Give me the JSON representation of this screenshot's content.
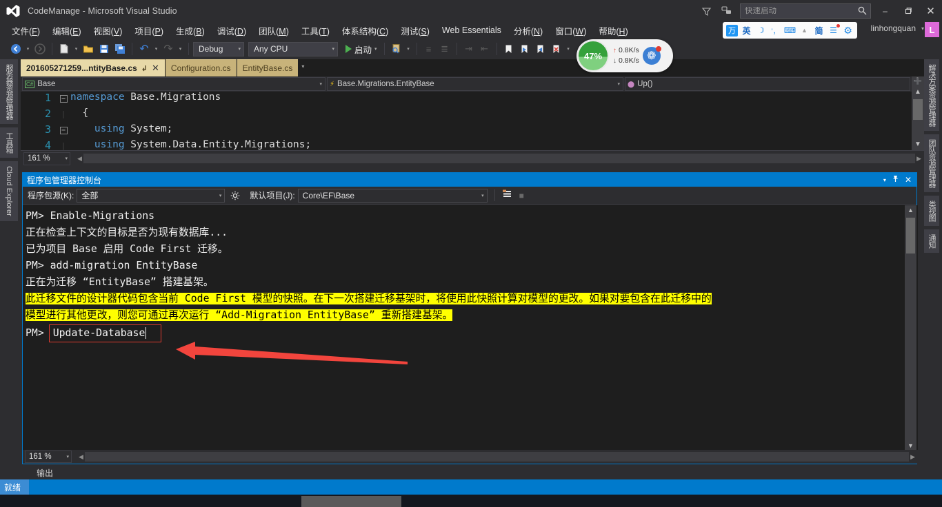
{
  "window": {
    "title": "CodeManage - Microsoft Visual Studio",
    "logo_icon": "visual-studio-logo",
    "minimize_label": "–",
    "maximize_label": "❐",
    "close_label": "✕"
  },
  "titlebar_icons": {
    "feedback_icon": "▽",
    "notify_icon": "⚒"
  },
  "quick_launch": {
    "placeholder": "快速启动",
    "value": "",
    "search_icon": "🔍"
  },
  "menu": {
    "items": [
      {
        "label": "文件(F)",
        "text": "文件(",
        "mnem": "F",
        "tail": ")"
      },
      {
        "label": "编辑(E)",
        "text": "编辑(",
        "mnem": "E",
        "tail": ")"
      },
      {
        "label": "视图(V)",
        "text": "视图(",
        "mnem": "V",
        "tail": ")"
      },
      {
        "label": "项目(P)",
        "text": "项目(",
        "mnem": "P",
        "tail": ")"
      },
      {
        "label": "生成(B)",
        "text": "生成(",
        "mnem": "B",
        "tail": ")"
      },
      {
        "label": "调试(D)",
        "text": "调试(",
        "mnem": "D",
        "tail": ")"
      },
      {
        "label": "团队(M)",
        "text": "团队(",
        "mnem": "M",
        "tail": ")"
      },
      {
        "label": "工具(T)",
        "text": "工具(",
        "mnem": "T",
        "tail": ")"
      },
      {
        "label": "体系结构(C)",
        "text": "体系结构(",
        "mnem": "C",
        "tail": ")"
      },
      {
        "label": "测试(S)",
        "text": "测试(",
        "mnem": "S",
        "tail": ")"
      },
      {
        "label": "Web Essentials",
        "text": "Web Essentials",
        "mnem": "",
        "tail": ""
      },
      {
        "label": "分析(N)",
        "text": "分析(",
        "mnem": "N",
        "tail": ")"
      },
      {
        "label": "窗口(W)",
        "text": "窗口(",
        "mnem": "W",
        "tail": ")"
      },
      {
        "label": "帮助(H)",
        "text": "帮助(",
        "mnem": "H",
        "tail": ")"
      }
    ]
  },
  "ime": {
    "icons": [
      "ime-logo-icon",
      "chinese-mode-icon",
      "moon-icon",
      "punctuation-icon",
      "keyboard-icon",
      "person-icon",
      "simplified-icon",
      "clipboard-icon",
      "settings-icon"
    ],
    "logo_glyph": "万",
    "mode_glyph": "英",
    "moon_glyph": "☽",
    "punct_glyph": "ʼ，",
    "keyboard_glyph": "⌨",
    "person_glyph": "▲",
    "simplified_glyph": "简",
    "clipboard_glyph": "☰",
    "settings_glyph": "⚙"
  },
  "account": {
    "user": "linhongquan",
    "caret": "▾",
    "avatar_initial": "L",
    "avatar_color": "#dd6ad9"
  },
  "toolbar": {
    "back_icon": "⬅",
    "forward_icon": "➡",
    "new_icon": "὜B",
    "open_icon": "Ὄ2",
    "save_icon": "ὋE",
    "save_all_icon": "὚B",
    "undo_icon": "↶",
    "redo_icon": "↷",
    "caret": "▾",
    "config_value": "Debug",
    "platform_value": "Any CPU",
    "run_label": "启动",
    "find_icon": "ὐE",
    "comment_icon": "≡",
    "uncomment_icon": "≣",
    "indent_icon": "⇥",
    "outdent_icon": "⇤",
    "bookmark_icon": "ὑ6",
    "bookmark_next_icon": "ὑ6",
    "bookmark_prev_icon": "ὑ6",
    "bookmark_clear_icon": "ὑ6"
  },
  "perf_widget": {
    "cpu_percent": "47%",
    "upload_rate": "0.8K/s",
    "download_rate": "0.8K/s",
    "up_arrow": "↑",
    "down_arrow": "↓",
    "badge_glyph": "❁",
    "circle_color": "#35a13b"
  },
  "left_rail": {
    "tabs": [
      {
        "label": "服务器资源管理器",
        "latin": false
      },
      {
        "label": "工具箱",
        "latin": false
      },
      {
        "label": "Cloud Explorer",
        "latin": true
      }
    ]
  },
  "right_rail": {
    "tabs": [
      {
        "label": "解决方案资源管理器"
      },
      {
        "label": "团队资源管理器"
      },
      {
        "label": "类视图"
      },
      {
        "label": "通知"
      }
    ]
  },
  "editor": {
    "tabs": [
      {
        "label": "201605271259...ntityBase.cs",
        "active": true,
        "pin_icon": "↲",
        "close_icon": "✕"
      },
      {
        "label": "Configuration.cs",
        "active": false
      },
      {
        "label": "EntityBase.cs",
        "active": false
      }
    ],
    "tabstrip_caret": "▾",
    "nav": {
      "project_icon": "C#",
      "project": "Base",
      "type_icon": "⚡",
      "type": "Base.Migrations.EntityBase",
      "member_icon": "⬤",
      "member": "Up()",
      "caret": "▾"
    },
    "lines": [
      {
        "num": "1",
        "fold": "−",
        "kw": "namespace",
        "rest": " Base.Migrations",
        "indent": ""
      },
      {
        "num": "2",
        "fold": "",
        "kw": "",
        "rest": "{",
        "indent": "  "
      },
      {
        "num": "3",
        "fold": "−",
        "kw": "using",
        "rest": " System;",
        "indent": "    "
      },
      {
        "num": "4",
        "fold": "",
        "kw": "using",
        "rest": " System.Data.Entity.Migrations;",
        "indent": "    "
      }
    ],
    "zoom_level": "161 %",
    "zoom_caret": "▾",
    "scroll_up_icon": "▲",
    "scroll_down_icon": "▼",
    "scroll_left_icon": "◀",
    "scroll_right_icon": "▶",
    "split_icon": "➕"
  },
  "console": {
    "title": "程序包管理器控制台",
    "title_caret": "▾",
    "pin_icon": "ὌC",
    "close_icon": "✕",
    "source_label": "程序包源(K):",
    "source_value": "全部",
    "gear_icon": "⚙",
    "project_label": "默认项目(J):",
    "project_value": "Core\\EF\\Base",
    "clear_icon": "≡",
    "stop_icon": "■",
    "caret": "▾",
    "lines": [
      {
        "text": "PM> Enable-Migrations",
        "highlight": false
      },
      {
        "text": "正在检查上下文的目标是否为现有数据库...",
        "highlight": false
      },
      {
        "text": "已为项目 Base 启用 Code First 迁移。",
        "highlight": false
      },
      {
        "text": "PM> add-migration EntityBase",
        "highlight": false
      },
      {
        "text": "正在为迁移 “EntityBase” 搭建基架。",
        "highlight": false
      },
      {
        "text": "此迁移文件的设计器代码包含当前 Code First 模型的快照。在下一次搭建迁移基架时，将使用此快照计算对模型的更改。如果对要包含在此迁移中的",
        "highlight": true
      },
      {
        "text": "模型进行其他更改，则您可通过再次运行 “Add-Migration EntityBase” 重新搭建基架。",
        "highlight": true
      }
    ],
    "prompt": "PM>",
    "input_value": "Update-Database",
    "zoom_level": "161 %",
    "zoom_caret": "▾"
  },
  "annotation": {
    "arrow_color": "#f2453d",
    "box_color": "#e03b30"
  },
  "bottom": {
    "output_tab": "输出",
    "status_text": "就绪",
    "taskbar_clock": ""
  }
}
